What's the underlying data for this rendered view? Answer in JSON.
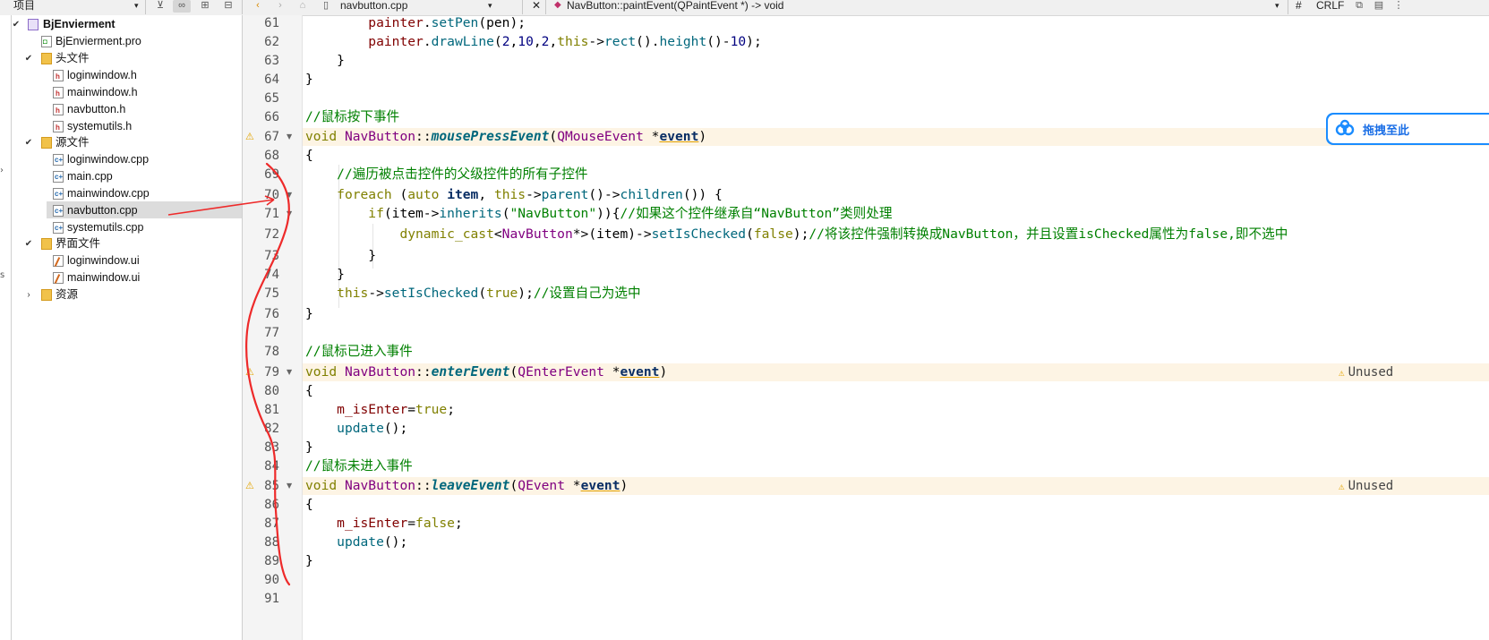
{
  "toolbar": {
    "project_label": "项目",
    "file_tab": "navbutton.cpp",
    "symbol": "NavButton::paintEvent(QPaintEvent *) -> void",
    "hash": "#",
    "line_ending": "CRLF"
  },
  "tree": {
    "root": "BjEnvierment",
    "pro_file": "BjEnvierment.pro",
    "headers_folder": "头文件",
    "headers": [
      "loginwindow.h",
      "mainwindow.h",
      "navbutton.h",
      "systemutils.h"
    ],
    "sources_folder": "源文件",
    "sources": [
      "loginwindow.cpp",
      "main.cpp",
      "mainwindow.cpp",
      "navbutton.cpp",
      "systemutils.cpp"
    ],
    "forms_folder": "界面文件",
    "forms": [
      "loginwindow.ui",
      "mainwindow.ui"
    ],
    "resources_folder": "资源",
    "selected": "navbutton.cpp"
  },
  "editor": {
    "line_numbers": [
      "61",
      "62",
      "63",
      "64",
      "65",
      "66",
      "67",
      "68",
      "69",
      "70",
      "71",
      "72",
      "73",
      "74",
      "75",
      "76",
      "77",
      "78",
      "79",
      "80",
      "81",
      "82",
      "83",
      "84",
      "85",
      "86",
      "87",
      "88",
      "89",
      "90",
      "91"
    ],
    "lines": {
      "l61_a": "painter",
      "l61_b": ".",
      "l61_c": "setPen",
      "l61_d": "(pen);",
      "l62_a": "painter",
      "l62_b": ".",
      "l62_c": "drawLine",
      "l62_d": "(",
      "l62_e": "2",
      "l62_f": ",",
      "l62_g": "10",
      "l62_h": ",",
      "l62_i": "2",
      "l62_j": ",",
      "l62_k": "this",
      "l62_l": "->",
      "l62_m": "rect",
      "l62_n": "().",
      "l62_o": "height",
      "l62_p": "()-",
      "l62_q": "10",
      "l62_r": ");",
      "l63": "}",
      "l64": "}",
      "l66": "//鼠标按下事件",
      "l67_a": "void",
      "l67_b": "NavButton",
      "l67_c": "::",
      "l67_d": "mousePressEvent",
      "l67_e": "(",
      "l67_f": "QMouseEvent",
      "l67_g": " *",
      "l67_h": "event",
      "l67_i": ")",
      "l68": "{",
      "l69": "//遍历被点击控件的父级控件的所有子控件",
      "l70_a": "foreach",
      "l70_b": " (",
      "l70_c": "auto",
      "l70_d": "item",
      "l70_e": ", ",
      "l70_f": "this",
      "l70_g": "->",
      "l70_h": "parent",
      "l70_i": "()->",
      "l70_j": "children",
      "l70_k": "()) {",
      "l71_a": "if",
      "l71_b": "(item->",
      "l71_c": "inherits",
      "l71_d": "(",
      "l71_e": "\"NavButton\"",
      "l71_f": ")){",
      "l71_g": "//如果这个控件继承自“NavButton”类则处理",
      "l72_a": "dynamic_cast",
      "l72_b": "<",
      "l72_c": "NavButton",
      "l72_d": "*>(item)->",
      "l72_e": "setIsChecked",
      "l72_f": "(",
      "l72_g": "false",
      "l72_h": ");",
      "l72_i": "//将该控件强制转换成NavButton，并且设置isChecked属性为false,即不选中",
      "l73": "}",
      "l74": "}",
      "l75_a": "this",
      "l75_b": "->",
      "l75_c": "setIsChecked",
      "l75_d": "(",
      "l75_e": "true",
      "l75_f": ");",
      "l75_g": "//设置自己为选中",
      "l76": "}",
      "l78": "//鼠标已进入事件",
      "l79_a": "void",
      "l79_b": "NavButton",
      "l79_c": "::",
      "l79_d": "enterEvent",
      "l79_e": "(",
      "l79_f": "QEnterEvent",
      "l79_g": " *",
      "l79_h": "event",
      "l79_i": ")",
      "l80": "{",
      "l81_a": "m_isEnter",
      "l81_b": "=",
      "l81_c": "true",
      "l81_d": ";",
      "l82_a": "update",
      "l82_b": "();",
      "l83": "}",
      "l84": "//鼠标未进入事件",
      "l85_a": "void",
      "l85_b": "NavButton",
      "l85_c": "::",
      "l85_d": "leaveEvent",
      "l85_e": "(",
      "l85_f": "QEvent",
      "l85_g": " *",
      "l85_h": "event",
      "l85_i": ")",
      "l86": "{",
      "l87_a": "m_isEnter",
      "l87_b": "=",
      "l87_c": "false",
      "l87_d": ";",
      "l88_a": "update",
      "l88_b": "();",
      "l89": "}"
    },
    "unused_label": "Unused",
    "warning_glyph": "⚠"
  },
  "float_button": {
    "label": "拖拽至此"
  },
  "colors": {
    "keyword": "#808000",
    "function": "#00677c",
    "comment": "#008000",
    "type": "#800080",
    "highlight": "#fdf4e4",
    "annotation": "#ee2a2a",
    "accent": "#1a8cff"
  }
}
